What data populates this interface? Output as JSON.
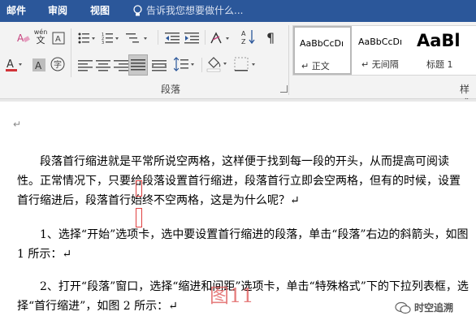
{
  "tabs": [
    {
      "label": "邮件"
    },
    {
      "label": "审阅"
    },
    {
      "label": "视图"
    }
  ],
  "tell_me": {
    "placeholder": "告诉我您想要做什么..."
  },
  "ribbon": {
    "paragraph_group_label": "段落",
    "styles_group_label": "样式",
    "phonetic_guide": "wén",
    "styles": [
      {
        "sample": "AaBbCcDı",
        "name": "↵ 正文",
        "selected": true
      },
      {
        "sample": "AaBbCcDı",
        "name": "↵ 无间隔",
        "selected": false
      },
      {
        "sample": "AaBl",
        "name": "标题 1",
        "selected": false
      }
    ]
  },
  "document": {
    "empty_line_mark": "↵",
    "paragraphs": [
      "段落首行缩进就是平常所说空两格，这样便于找到每一段的开头，从而提高可阅读性。正常情况下，只要给段落设置首行缩进，段落首行立即会空两格，但有的时候，设置首行缩进后，段落首行始终不空两格，这是为什么呢？↵",
      "1、选择“开始”选项卡，选中要设置首行缩进的段落，单击“段落”右边的斜箭头，如图 1 所示：↵",
      "2、打开“段落”窗口，选择“缩进和间距”选项卡，单击“特殊格式”下的下拉列表框，选择“首行缩进”，如图 2 所示：↵"
    ],
    "stamp_text": "图11"
  },
  "watermark": {
    "text": "时空追溯"
  },
  "colors": {
    "title_bar": "#2b579a",
    "font_color_underline": "#d13438",
    "highlight": "#ffff00"
  }
}
